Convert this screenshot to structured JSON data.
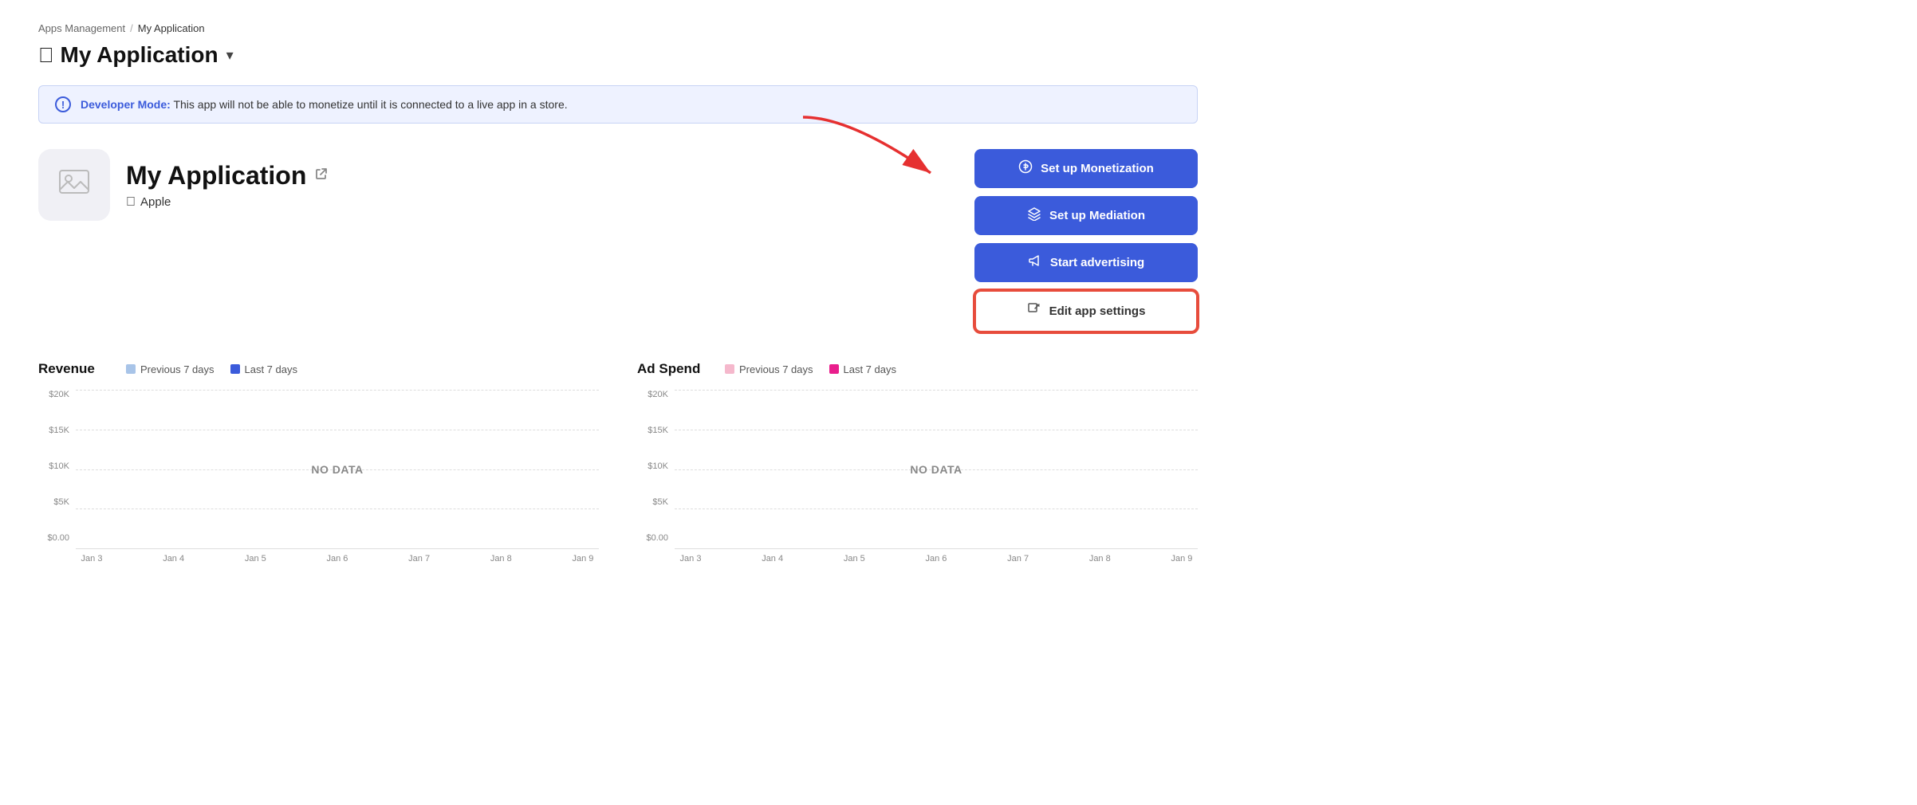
{
  "breadcrumb": {
    "parent": "Apps Management",
    "separator": "/",
    "current": "My Application"
  },
  "pageTitle": {
    "icon": "",
    "text": "My Application",
    "chevron": "▾"
  },
  "devBanner": {
    "label": "Developer Mode:",
    "message": " This app will not be able to monetize until it is connected to a live app in a store."
  },
  "app": {
    "name": "My Application",
    "platform": "Apple",
    "externalLinkIcon": "⧉"
  },
  "buttons": {
    "setupMonetization": "Set up Monetization",
    "setupMediation": "Set up Mediation",
    "startAdvertising": "Start advertising",
    "editAppSettings": "Edit app settings"
  },
  "revenueChart": {
    "title": "Revenue",
    "legend": {
      "prev": "Previous 7 days",
      "last": "Last 7 days",
      "prevColor": "#a8c4e8",
      "lastColor": "#3b5bdb"
    },
    "yLabels": [
      "$20K",
      "$15K",
      "$10K",
      "$5K",
      "$0.00"
    ],
    "xLabels": [
      "Jan 3",
      "Jan 4",
      "Jan 5",
      "Jan 6",
      "Jan 7",
      "Jan 8",
      "Jan 9"
    ],
    "noData": "NO DATA"
  },
  "adSpendChart": {
    "title": "Ad Spend",
    "legend": {
      "prev": "Previous 7 days",
      "last": "Last 7 days",
      "prevColor": "#f5b8cc",
      "lastColor": "#e91e8c"
    },
    "yLabels": [
      "$20K",
      "$15K",
      "$10K",
      "$5K",
      "$0.00"
    ],
    "xLabels": [
      "Jan 3",
      "Jan 4",
      "Jan 5",
      "Jan 6",
      "Jan 7",
      "Jan 8",
      "Jan 9"
    ],
    "noData": "NO DATA"
  }
}
